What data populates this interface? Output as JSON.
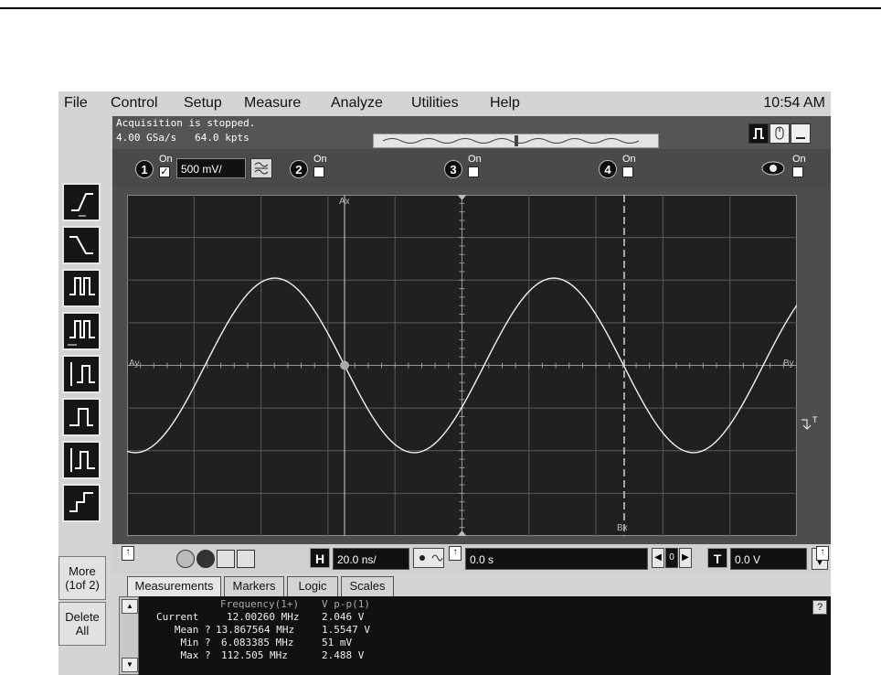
{
  "menubar": {
    "items": [
      "File",
      "Control",
      "Setup",
      "Measure",
      "Analyze",
      "Utilities",
      "Help"
    ],
    "clock": "10:54 AM"
  },
  "status": {
    "line1": "Acquisition is stopped.",
    "line2": "4.00 GSa/s   64.0 kpts"
  },
  "channels": {
    "on_label": "On",
    "ch1": {
      "number": "1",
      "checked": "✓",
      "scale": "500 mV/"
    },
    "ch2": {
      "number": "2"
    },
    "ch3": {
      "number": "3"
    },
    "ch4": {
      "number": "4"
    }
  },
  "left_toolbar": {
    "more_label": "More\n(1of 2)",
    "delete_label": "Delete\nAll"
  },
  "graticule": {
    "marker_ax": "Ax",
    "marker_ay": "Ay",
    "marker_bx": "Bx",
    "marker_by": "By"
  },
  "controls": {
    "horizontal_icon": "H",
    "timebase": "20.0 ns/",
    "delay": "0.0 s",
    "delay_center": "0",
    "trigger_icon": "T",
    "trigger_level": "0.0 V"
  },
  "tabs": [
    "Measurements",
    "Markers",
    "Logic",
    "Scales"
  ],
  "measurements": {
    "help_label": "?",
    "header_freq": "Frequency(1+)",
    "header_vpp": "V p-p(1)",
    "rows": [
      {
        "label": "Current  ",
        "freq": "12.00260 MHz",
        "vpp": "2.046 V"
      },
      {
        "label": "   Mean ?",
        "freq": "13.867564 MHz",
        "vpp": "1.5547 V"
      },
      {
        "label": "    Min ?",
        "freq": "6.083385 MHz",
        "vpp": "51 mV"
      },
      {
        "label": "    Max ?",
        "freq": "112.505 MHz",
        "vpp": "2.488 V"
      }
    ]
  },
  "colors": {
    "screen_bg": "#202020",
    "trace": "#f2f2f2",
    "grid": "#5a5a5a"
  },
  "waveform": {
    "type": "sine",
    "frequency_mhz": 12.0026,
    "vpp_v": 2.046,
    "volts_per_div": 0.5,
    "time_per_div_ns": 20
  }
}
